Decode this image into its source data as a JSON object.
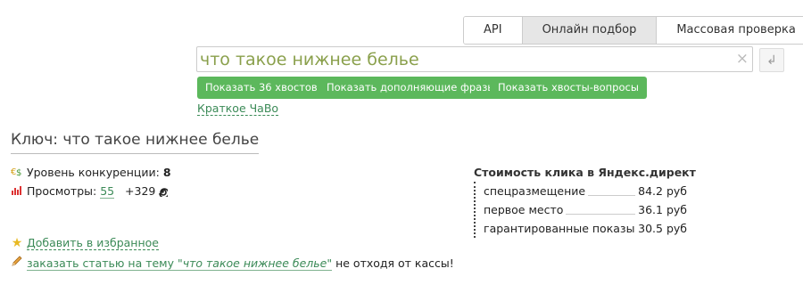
{
  "tabs": [
    {
      "label": "API",
      "active": false
    },
    {
      "label": "Онлайн подбор",
      "active": true
    },
    {
      "label": "Массовая проверка",
      "active": false
    }
  ],
  "search": {
    "value": "что такое нижнее белье",
    "clear_icon": "×",
    "enter_icon": "↲"
  },
  "buttons": {
    "tails": "Показать 36 хвостов",
    "extra": "Показать дополняющие фразы",
    "questions": "Показать хвосты-вопросы"
  },
  "faq_link": "Краткое ЧаВо",
  "key": {
    "prefix": "Ключ: ",
    "phrase": "что такое нижнее белье"
  },
  "stats": {
    "competition_label": "Уровень конкуренции: ",
    "competition_value": "8",
    "views_label": "Просмотры: ",
    "views_value": "55",
    "views_delta": "+329"
  },
  "cost": {
    "title": "Стоимость клика в Яндекс.директ",
    "items": [
      {
        "label": "спецразмещение",
        "value": "84.2 руб"
      },
      {
        "label": "первое место",
        "value": "36.1 руб"
      },
      {
        "label": "гарантированные показы",
        "value": "30.5 руб"
      }
    ]
  },
  "favorite_link": "Добавить в избранное",
  "order": {
    "link_prefix": "заказать статью на тему ",
    "link_phrase": "\"что такое нижнее белье\"",
    "suffix": " не отходя от кассы!"
  },
  "colors": {
    "accent_green": "#5cb85c",
    "link_green": "#3b8a57",
    "input_text": "#8aa04c"
  }
}
